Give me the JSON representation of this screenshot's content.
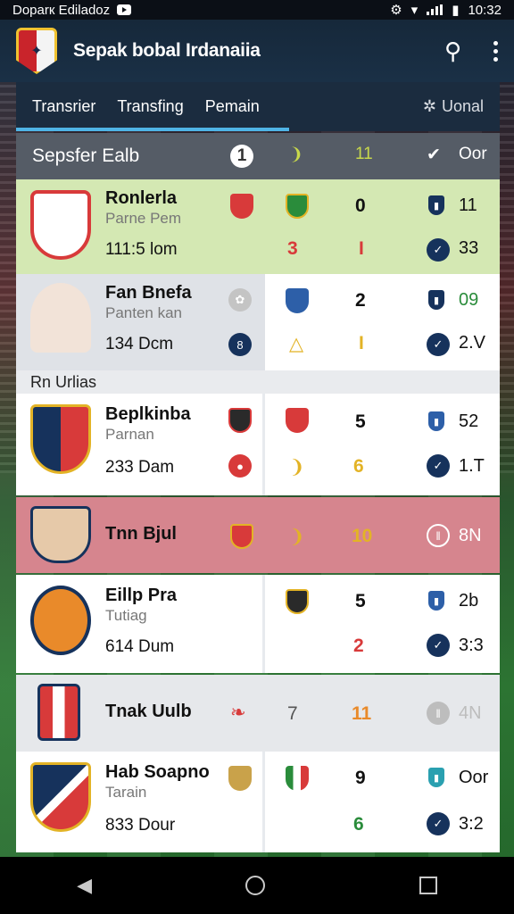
{
  "status_bar": {
    "left_text": "Doparк Ediladoz",
    "time": "10:32"
  },
  "app": {
    "title": "Sepak bobal Irdanaiia"
  },
  "tabs": [
    {
      "label": "Transrier",
      "active": true
    },
    {
      "label": "Transfing",
      "active": true
    },
    {
      "label": "Pemain",
      "active": false
    }
  ],
  "tabs_more": "Uonal",
  "header": {
    "name": "Sepsfer Ealb",
    "col1": "1",
    "col3": "11",
    "col4": "Oor"
  },
  "section_label": "Rn Urlias",
  "rows": [
    {
      "name": "Ronlerla",
      "sub": "Parne Pem",
      "time": "111:5 lom",
      "score1": "0",
      "score2": "3",
      "flag": "I",
      "stat1": "11",
      "stat2": "33"
    },
    {
      "name": "Fan Bnefa",
      "sub": "Panten kan",
      "time": "134 Dcm",
      "badge": "8",
      "score1": "2",
      "flag": "I",
      "stat1": "09",
      "stat2": "2.V"
    },
    {
      "name": "Beplkinba",
      "sub": "Parnan",
      "time": "233 Dam",
      "score1": "5",
      "score2": "6",
      "stat1": "52",
      "stat2": "1.T"
    },
    {
      "name": "Tnn Bjul",
      "score1": "10",
      "stat1": "8N"
    },
    {
      "name": "Eillp Pra",
      "sub": "Tutiag",
      "time": "614 Dum",
      "score1": "5",
      "score2": "2",
      "stat1": "2b",
      "stat2": "3:3"
    },
    {
      "name": "Tnak Uulb",
      "score0": "7",
      "score1": "11",
      "stat1": "4N"
    },
    {
      "name": "Hab Soapno",
      "sub": "Tarain",
      "time": "833 Dour",
      "score1": "9",
      "score2": "6",
      "stat1": "Oor",
      "stat2": "3:2"
    }
  ],
  "colors": {
    "accent_red": "#d83a3a",
    "accent_yellow": "#e3b326",
    "accent_green": "#2a8c3b",
    "navy": "#16325c"
  }
}
